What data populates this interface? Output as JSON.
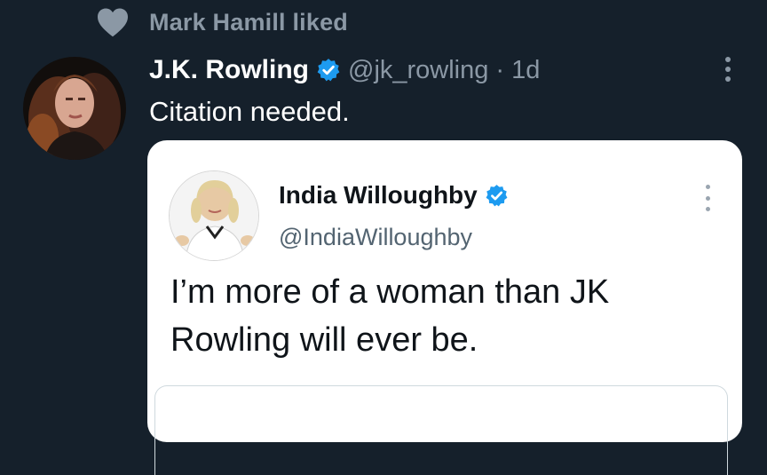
{
  "social_context": {
    "icon": "heart-icon",
    "text": "Mark Hamill liked"
  },
  "tweet": {
    "author_name": "J.K. Rowling",
    "verified": true,
    "handle": "@jk_rowling",
    "separator": "·",
    "time": "1d",
    "text": "Citation needed."
  },
  "quoted_tweet": {
    "author_name": "India Willoughby",
    "verified": true,
    "handle": "@IndiaWilloughby",
    "text": "I’m more of a woman than JK Rowling will ever be."
  },
  "colors": {
    "background": "#15202b",
    "secondary_text": "#8b98a5",
    "verified_blue": "#1d9bf0",
    "card_background": "#ffffff"
  }
}
